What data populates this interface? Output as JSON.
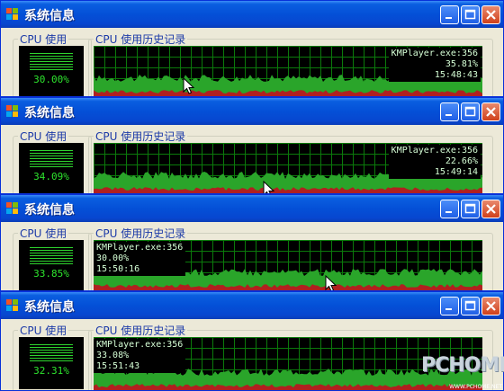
{
  "windows": [
    {
      "title": "系统信息",
      "cpu_usage_label": "CPU 使用",
      "cpu_history_label": "CPU 使用历史记录",
      "cpu_percent": "30.00%",
      "process": "KMPlayer.exe:356",
      "proc_percent": "35.81%",
      "time": "15:48:43",
      "info_align": "right"
    },
    {
      "title": "系统信息",
      "cpu_usage_label": "CPU 使用",
      "cpu_history_label": "CPU 使用历史记录",
      "cpu_percent": "34.09%",
      "process": "KMPlayer.exe:356",
      "proc_percent": "22.66%",
      "time": "15:49:14",
      "info_align": "right"
    },
    {
      "title": "系统信息",
      "cpu_usage_label": "CPU 使用",
      "cpu_history_label": "CPU 使用历史记录",
      "cpu_percent": "33.85%",
      "process": "KMPlayer.exe:356",
      "proc_percent": "30.00%",
      "time": "15:50:16",
      "info_align": "left"
    },
    {
      "title": "系统信息",
      "cpu_usage_label": "CPU 使用",
      "cpu_history_label": "CPU 使用历史记录",
      "cpu_percent": "32.31%",
      "process": "KMPlayer.exe:356",
      "proc_percent": "33.08%",
      "time": "15:51:43",
      "info_align": "left"
    }
  ],
  "colors": {
    "titlebar": "#0450d7",
    "graph_bg": "#000000",
    "grid": "#0b7a0b",
    "cpu_fill": "#2aa52a",
    "kernel_fill": "#b02020"
  },
  "watermark": {
    "text": "PCHOME",
    "url": "WWW.PCHOME.NET"
  }
}
